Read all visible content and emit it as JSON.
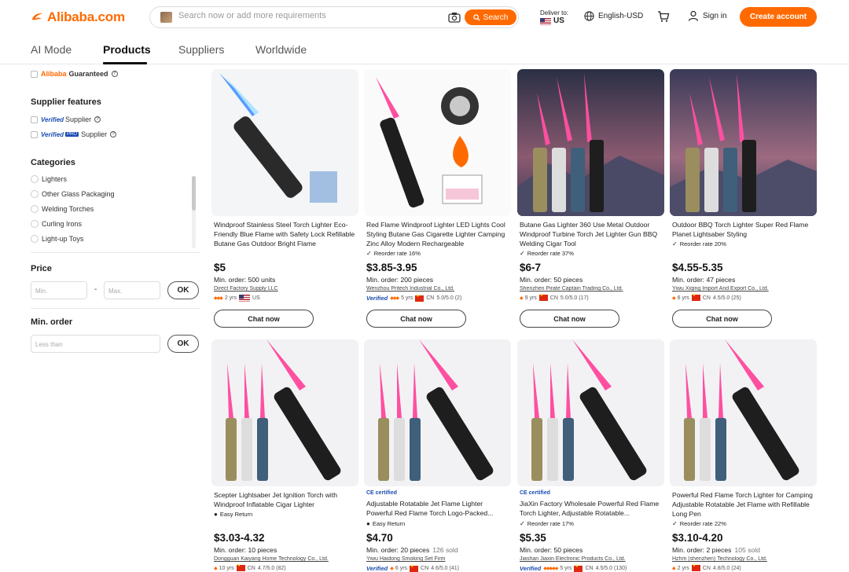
{
  "header": {
    "logo": "Alibaba.com",
    "search_placeholder": "Search now or add more requirements",
    "search_button": "Search",
    "deliver_to_label": "Deliver to:",
    "deliver_country": "US",
    "language": "English-USD",
    "sign_in": "Sign in",
    "create_account": "Create account",
    "brand_color": "#ff6a00"
  },
  "tabs": [
    {
      "label": "AI Mode",
      "active": false
    },
    {
      "label": "Products",
      "active": true
    },
    {
      "label": "Suppliers",
      "active": false
    },
    {
      "label": "Worldwide",
      "active": false
    }
  ],
  "sidebar": {
    "guaranteed": {
      "brand": "Alibaba",
      "label": "Guaranteed"
    },
    "supplier_features": {
      "title": "Supplier features",
      "items": [
        {
          "tag": "Verified",
          "label": "Supplier"
        },
        {
          "tag": "Verified",
          "pro": "PRO",
          "label": "Supplier"
        }
      ]
    },
    "categories": {
      "title": "Categories",
      "items": [
        "Lighters",
        "Other Glass Packaging",
        "Welding Torches",
        "Curling Irons",
        "Light-up Toys"
      ]
    },
    "price": {
      "title": "Price",
      "min_placeholder": "Min.",
      "separator": "-",
      "max_placeholder": "Max.",
      "ok": "OK"
    },
    "min_order": {
      "title": "Min. order",
      "placeholder": "Less than",
      "ok": "OK"
    }
  },
  "products": [
    {
      "title": "Windproof Stainless Steel Torch Lighter Eco-Friendly Blue Flame with Safety Lock Refillable Butane Gas Outdoor Bright Flame",
      "tag": "",
      "price": "$5",
      "moq": "Min. order: 500 units",
      "sold": "",
      "supplier": "Direct Factory Supply LLC",
      "years": "2 yrs",
      "country": "US",
      "rating": "",
      "verified": false,
      "chat": "Chat now"
    },
    {
      "title": "Red Flame Windproof Lighter LED Lights Cool Styling Butane Gas Cigarette Lighter Camping Zinc Alloy Modern Rechargeable",
      "tag": "Reorder rate 16%",
      "price": "$3.85-3.95",
      "moq": "Min. order: 200 pieces",
      "sold": "",
      "supplier": "Wenzhou Pritech Industrial Co., Ltd.",
      "years": "5 yrs",
      "country": "CN",
      "rating": "5.0/5.0 (2)",
      "verified": true,
      "chat": "Chat now"
    },
    {
      "title": "Butane Gas Lighter 360 Use Metal Outdoor Windproof Turbine Torch Jet Lighter Gun BBQ Welding Cigar Tool",
      "tag": "Reorder rate 37%",
      "price": "$6-7",
      "moq": "Min. order: 50 pieces",
      "sold": "",
      "supplier": "Shenzhen Pirate Captain Trading Co., Ltd.",
      "years": "9 yrs",
      "country": "CN",
      "rating": "5.0/5.0 (17)",
      "verified": false,
      "chat": "Chat now"
    },
    {
      "title": "Outdoor BBQ Torch Lighter Super Red Flame Planet Lightsaber Styling",
      "tag": "Reorder rate 20%",
      "price": "$4.55-5.35",
      "moq": "Min. order: 47 pieces",
      "sold": "",
      "supplier": "Yiwu Xiqing Import And Export Co., Ltd.",
      "years": "6 yrs",
      "country": "CN",
      "rating": "4.5/5.0 (25)",
      "verified": false,
      "chat": "Chat now"
    },
    {
      "certified": "",
      "title": "Scepter Lightsaber Jet Ignition Torch with Windproof Inflatable Cigar Lighter",
      "tag": "Easy Return",
      "price": "$3.03-4.32",
      "moq": "Min. order: 10 pieces",
      "sold": "",
      "supplier": "Dongguan Kaiyang Home Technology Co., Ltd.",
      "years": "10 yrs",
      "country": "CN",
      "rating": "4.7/5.0 (82)",
      "verified": false
    },
    {
      "certified": "CE certified",
      "title": "Adjustable Rotatable Jet Flame Lighter Powerful Red Flame Torch Logo-Packed...",
      "tag": "Easy Return",
      "price": "$4.70",
      "moq": "Min. order: 20 pieces",
      "sold": "126 sold",
      "supplier": "Yiwu Haidong Smoking Set Firm",
      "years": "6 yrs",
      "country": "CN",
      "rating": "4.6/5.0 (41)",
      "verified": true
    },
    {
      "certified": "CE certified",
      "title": "JiaXin Factory Wholesale Powerful Red Flame Torch Lighter, Adjustable Rotatable...",
      "tag": "Reorder rate 17%",
      "price": "$5.35",
      "moq": "Min. order: 50 pieces",
      "sold": "",
      "supplier": "Jiashan Jiaxin Electronic Products Co., Ltd.",
      "years": "5 yrs",
      "country": "CN",
      "rating": "4.5/5.0 (130)",
      "verified": true
    },
    {
      "certified": "",
      "title": "Powerful Red Flame Torch Lighter for Camping Adjustable Rotatable Jet Flame with Refillable Long Pen",
      "tag": "Reorder rate 22%",
      "price": "$3.10-4.20",
      "moq": "Min. order: 2 pieces",
      "sold": "105 sold",
      "supplier": "Hzhm (shenzhen) Technology Co., Ltd.",
      "years": "2 yrs",
      "country": "CN",
      "rating": "4.8/5.0 (24)",
      "verified": false
    }
  ]
}
